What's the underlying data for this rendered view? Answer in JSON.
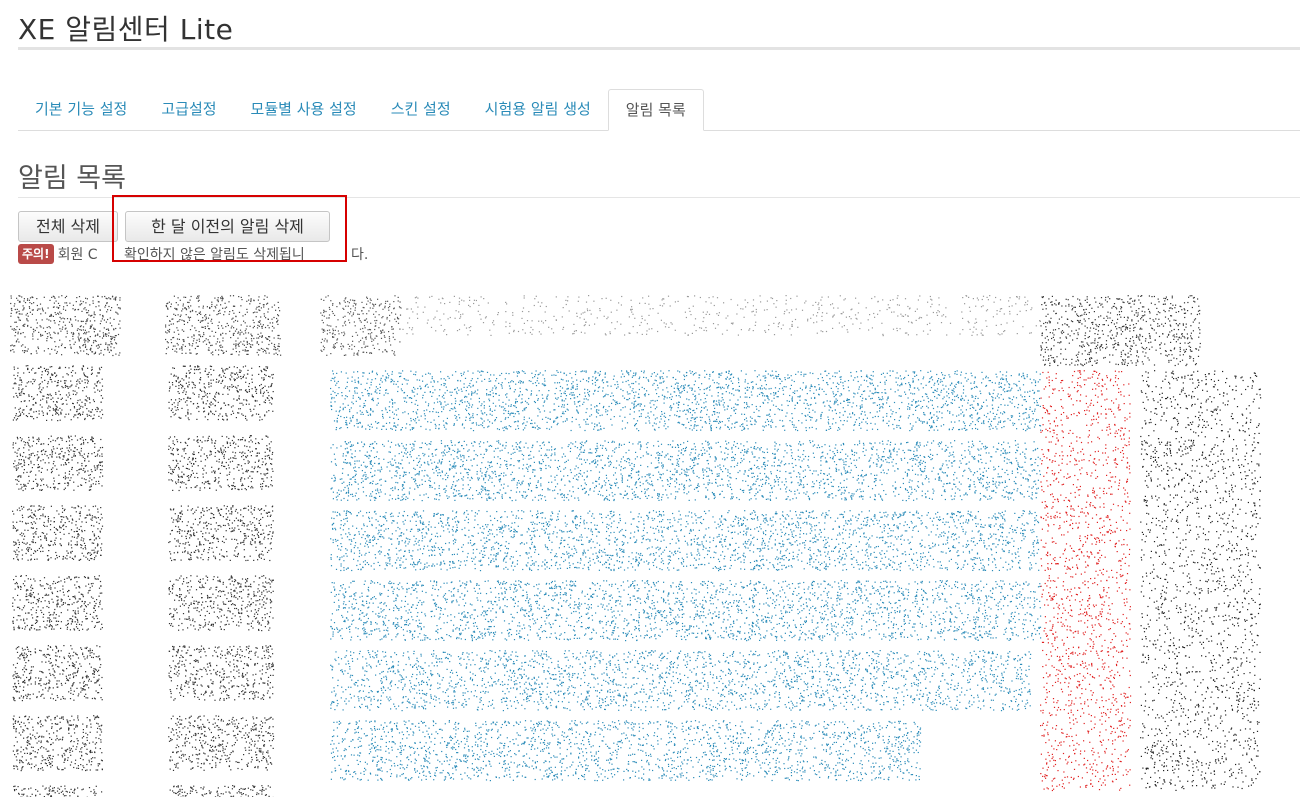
{
  "app": {
    "title": "XE 알림센터 Lite"
  },
  "tabs": [
    {
      "label": "기본 기능 설정",
      "active": false
    },
    {
      "label": "고급설정",
      "active": false
    },
    {
      "label": "모듈별 사용 설정",
      "active": false
    },
    {
      "label": "스킨 설정",
      "active": false
    },
    {
      "label": "시험용 알림 생성",
      "active": false
    },
    {
      "label": "알림 목록",
      "active": true
    }
  ],
  "section": {
    "title": "알림 목록"
  },
  "actions": {
    "delete_all_label": "전체 삭제",
    "delete_old_label": "한 달 이전의 알림 삭제"
  },
  "notice": {
    "badge": "주의!",
    "text_start": "회원 C",
    "text_hidden": "확인하지 않은 알림도 삭제됩니",
    "text_end": "다."
  },
  "colors": {
    "link": "#2a8bb8",
    "badge": "#b94a48",
    "highlight": "#d60000",
    "status_red": "#e02020"
  }
}
